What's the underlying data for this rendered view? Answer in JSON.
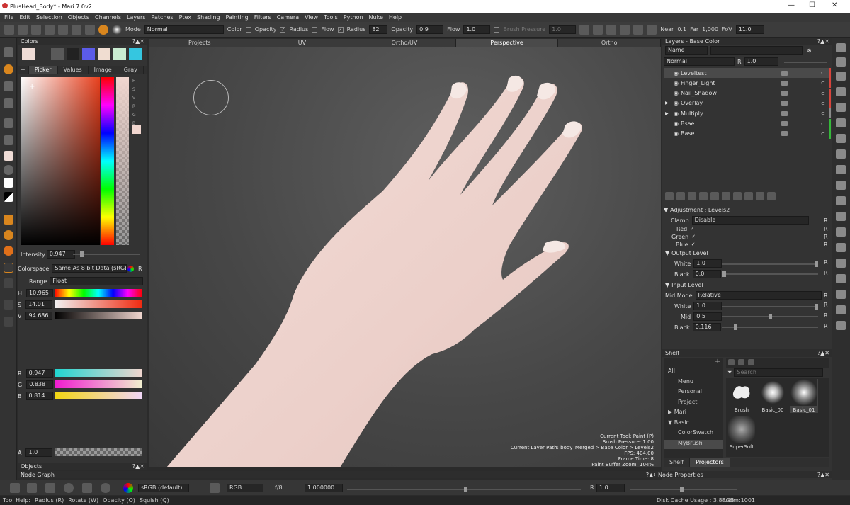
{
  "window": {
    "title": "PlusHead_Body* - Mari 7.0v2",
    "min": "—",
    "max": "☐",
    "close": "✕"
  },
  "menu": [
    "File",
    "Edit",
    "Selection",
    "Objects",
    "Channels",
    "Layers",
    "Patches",
    "Ptex",
    "Shading",
    "Painting",
    "Filters",
    "Camera",
    "View",
    "Tools",
    "Python",
    "Nuke",
    "Help"
  ],
  "toolbar": {
    "mode_label": "Mode",
    "mode_value": "Normal",
    "color_label": "Color",
    "opacity_label": "Opacity",
    "radius_label": "Radius",
    "flow_label": "Flow",
    "radius_label2": "Radius",
    "radius_value": "82",
    "opacity_label2": "Opacity",
    "opacity_value": "0.9",
    "flow_label2": "Flow",
    "flow_value": "1.0",
    "brush_pressure_label": "Brush Pressure",
    "brush_pressure_value": "1.0",
    "near_label": "Near",
    "near_value": "0.1",
    "far_label": "Far",
    "far_value": "1,000",
    "fov_label": "FoV",
    "fov_value": "11.0",
    "check": "✓"
  },
  "colors_panel": {
    "title": "Colors",
    "header_icons": "?▲✕",
    "swatches": [
      "#efdcd6",
      "#5a5a5a",
      "#222222",
      "#5b5be8",
      "#f0ddd1",
      "#c9ecd1",
      "#35c6e0"
    ],
    "tabs": [
      "Picker",
      "Values",
      "Image",
      "Gray"
    ],
    "active_tab": "Picker",
    "channel_letters": [
      "H",
      "S",
      "V",
      "R",
      "G",
      "B"
    ],
    "intensity_label": "Intensity",
    "intensity_value": "0.947",
    "colorspace_label": "Colorspace",
    "colorspace_value": "Same As 8 bit Data (sRGB",
    "range_label": "Range",
    "range_value": "Float",
    "hsv": [
      {
        "label": "H",
        "value": "10.965"
      },
      {
        "label": "S",
        "value": "14.01"
      },
      {
        "label": "V",
        "value": "94.686"
      }
    ],
    "rgb": [
      {
        "label": "R",
        "value": "0.947"
      },
      {
        "label": "G",
        "value": "0.838"
      },
      {
        "label": "B",
        "value": "0.814"
      }
    ],
    "alpha": {
      "label": "A",
      "value": "1.0"
    },
    "current_color": "#f1d6cf",
    "r_btn": "R"
  },
  "objects_panel": {
    "title": "Objects"
  },
  "node_graph": {
    "title": "Node Graph"
  },
  "viewport": {
    "tabs": [
      "Projects",
      "UV",
      "Ortho/UV",
      "Perspective",
      "Ortho"
    ],
    "active_tab": "Perspective",
    "hud": {
      "current_tool": "Current Tool: Paint (P)",
      "brush_pressure": "Brush Pressure: 1.00",
      "layer_path": "Current Layer Path: body_Merged > Base Color > Levels2",
      "fps": "FPS: 404.00",
      "frame_time": "Frame Time: 8",
      "zoom": "Paint Buffer Zoom: 104%"
    }
  },
  "layers_panel": {
    "title": "Layers - Base Color",
    "name_filter": "Name",
    "blend_mode": "Normal",
    "r_btn": "R",
    "opacity": "1.0",
    "layers": [
      {
        "name": "Leveltest",
        "selected": true,
        "expander": "",
        "tag": "#d8443c"
      },
      {
        "name": "Finger_Light",
        "selected": false,
        "expander": "",
        "tag": "#d8443c"
      },
      {
        "name": "Nail_Shadow",
        "selected": false,
        "expander": "",
        "tag": "#d8443c"
      },
      {
        "name": "Overlay",
        "selected": false,
        "expander": "▶",
        "tag": "#d8443c"
      },
      {
        "name": "Multiply",
        "selected": false,
        "expander": "▶",
        "tag": "#8a8a8a"
      },
      {
        "name": "Bsae",
        "selected": false,
        "expander": "",
        "tag": "#35b83a"
      },
      {
        "name": "Base",
        "selected": false,
        "expander": "",
        "tag": "#35b83a"
      }
    ]
  },
  "adjustment": {
    "title": "Adjustment : Levels2",
    "clamp_label": "Clamp",
    "clamp_value": "Disable",
    "channels": [
      {
        "label": "Red"
      },
      {
        "label": "Green"
      },
      {
        "label": "Blue"
      }
    ],
    "check": "✓",
    "output_title": "Output Level",
    "output_white_label": "White",
    "output_white_value": "1.0",
    "output_black_label": "Black",
    "output_black_value": "0.0",
    "input_title": "Input Level",
    "mid_mode_label": "Mid Mode",
    "mid_mode_value": "Relative",
    "input_white_label": "White",
    "input_white_value": "1.0",
    "mid_label": "Mid",
    "mid_value": "0.5",
    "input_black_label": "Black",
    "input_black_value": "0.116",
    "r_btn": "R"
  },
  "shelf": {
    "title": "Shelf",
    "search_placeholder": "Search",
    "tree": [
      "All",
      "Menu",
      "Personal",
      "Project",
      "Mari",
      "Basic",
      "ColorSwatch",
      "MyBrush"
    ],
    "selected_tree": "MyBrush",
    "items": [
      {
        "name": "Brush"
      },
      {
        "name": "Basic_00"
      },
      {
        "name": "Basic_01"
      },
      {
        "name": "SuperSoft"
      }
    ],
    "tabs": [
      "Shelf",
      "Projectors"
    ]
  },
  "node_properties": {
    "title": "Node Properties"
  },
  "bottom_bar": {
    "colorspace": "sRGB (default)",
    "channels": "RGB",
    "fstop": "f/8",
    "gain": "1.000000",
    "r_label": "R",
    "exposure": "1.0"
  },
  "status": {
    "tool_help_label": "Tool Help:",
    "hints": [
      "Radius (R)",
      "Rotate (W)",
      "Opacity (O)",
      "Squish (Q)"
    ],
    "disk_cache": "Disk Cache Usage : 3.88GB",
    "udim": "Udim:1001"
  }
}
